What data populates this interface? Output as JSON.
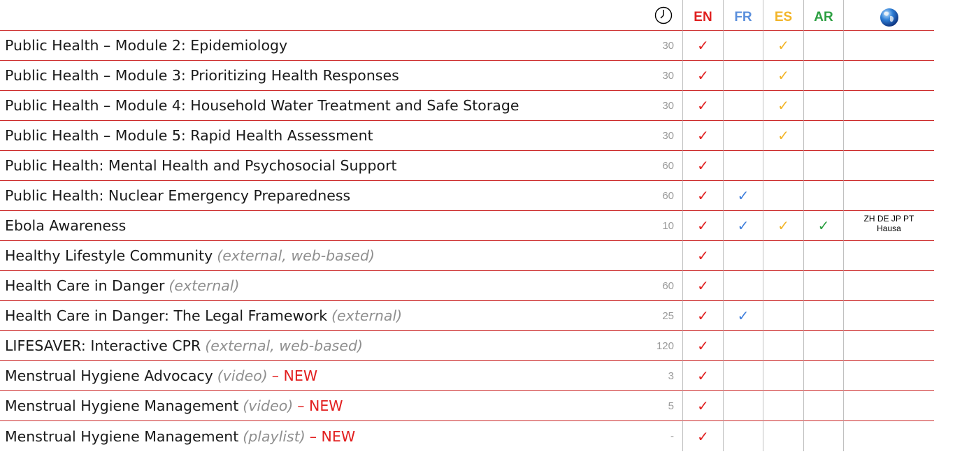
{
  "header": {
    "duration_icon": "clock-icon",
    "languages": [
      {
        "label": "EN",
        "color": "#e02020"
      },
      {
        "label": "FR",
        "color": "#5b8fdc"
      },
      {
        "label": "ES",
        "color": "#f2b52a"
      },
      {
        "label": "AR",
        "color": "#2ea043"
      }
    ],
    "other_languages_icon": "globe-icon"
  },
  "check_glyph": "✓",
  "rows": [
    {
      "title": "Public Health – Module 2: Epidemiology",
      "note": "",
      "new": "",
      "duration": "30",
      "langs": [
        "EN",
        "ES"
      ],
      "other": []
    },
    {
      "title": "Public Health – Module 3: Prioritizing Health Responses",
      "note": "",
      "new": "",
      "duration": "30",
      "langs": [
        "EN",
        "ES"
      ],
      "other": []
    },
    {
      "title": "Public Health – Module 4: Household Water Treatment and Safe Storage",
      "note": "",
      "new": "",
      "duration": "30",
      "langs": [
        "EN",
        "ES"
      ],
      "other": []
    },
    {
      "title": "Public Health – Module 5: Rapid Health Assessment",
      "note": "",
      "new": "",
      "duration": "30",
      "langs": [
        "EN",
        "ES"
      ],
      "other": []
    },
    {
      "title": "Public Health: Mental Health and Psychosocial Support",
      "note": "",
      "new": "",
      "duration": "60",
      "langs": [
        "EN"
      ],
      "other": []
    },
    {
      "title": "Public Health: Nuclear Emergency Preparedness",
      "note": "",
      "new": "",
      "duration": "60",
      "langs": [
        "EN",
        "FR"
      ],
      "other": []
    },
    {
      "title": "Ebola Awareness",
      "note": "",
      "new": "",
      "duration": "10",
      "langs": [
        "EN",
        "FR",
        "ES",
        "AR"
      ],
      "other": [
        "ZH DE JP PT",
        "Hausa"
      ]
    },
    {
      "title": "Healthy Lifestyle Community",
      "note": "(external, web-based)",
      "new": "",
      "duration": "",
      "langs": [
        "EN"
      ],
      "other": []
    },
    {
      "title": "Health Care in Danger",
      "note": "(external)",
      "new": "",
      "duration": "60",
      "langs": [
        "EN"
      ],
      "other": []
    },
    {
      "title": "Health Care in Danger: The Legal Framework",
      "note": "(external)",
      "new": "",
      "duration": "25",
      "langs": [
        "EN",
        "FR"
      ],
      "other": []
    },
    {
      "title": "LIFESAVER: Interactive CPR",
      "note": "(external, web-based)",
      "new": "",
      "duration": "120",
      "langs": [
        "EN"
      ],
      "other": []
    },
    {
      "title": "Menstrual Hygiene Advocacy",
      "note": "(video)",
      "new": "– NEW",
      "duration": "3",
      "langs": [
        "EN"
      ],
      "other": []
    },
    {
      "title": "Menstrual Hygiene Management",
      "note": "(video)",
      "new": "– NEW",
      "duration": "5",
      "langs": [
        "EN"
      ],
      "other": []
    },
    {
      "title": "Menstrual Hygiene Management",
      "note": "(playlist)",
      "new": "– NEW",
      "duration": "-",
      "langs": [
        "EN"
      ],
      "other": []
    }
  ]
}
